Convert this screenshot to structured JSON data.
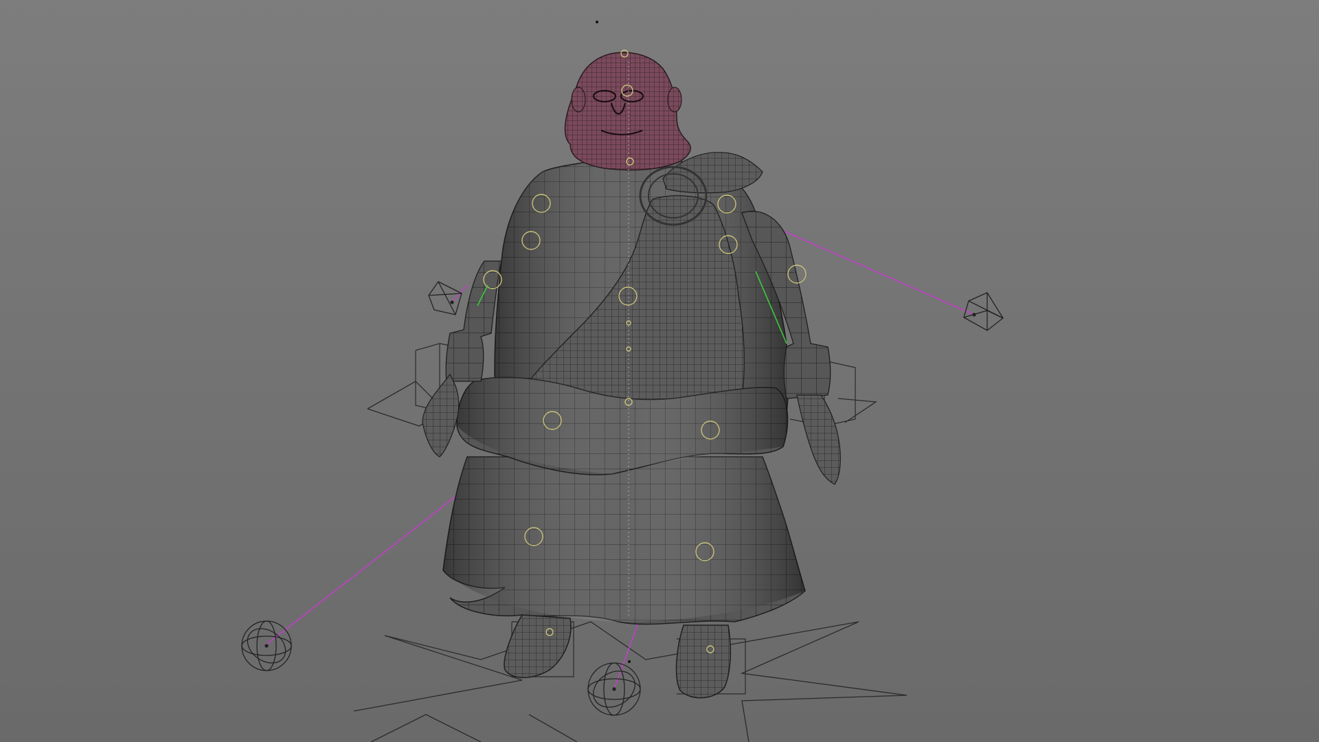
{
  "viewport": {
    "background_top": "#7d7d7d",
    "background_bottom": "#6a6a6a",
    "mesh_color": "#5a5a5a",
    "mesh_line_color": "#1e1e1e",
    "head_color": "#7a4a5c",
    "head_line_color": "#2a1a20",
    "control_circle_color": "#c8c27a",
    "pole_vector_line_color": "#c040c8",
    "ik_line_color": "#3cc83c",
    "locator_color": "#222222"
  },
  "scene": {
    "object": "character-rig",
    "selected_part": "head",
    "icons": [
      "octahedron-locator-icon",
      "sphere-locator-icon",
      "star-ground-control-icon",
      "box-locator-icon"
    ]
  }
}
